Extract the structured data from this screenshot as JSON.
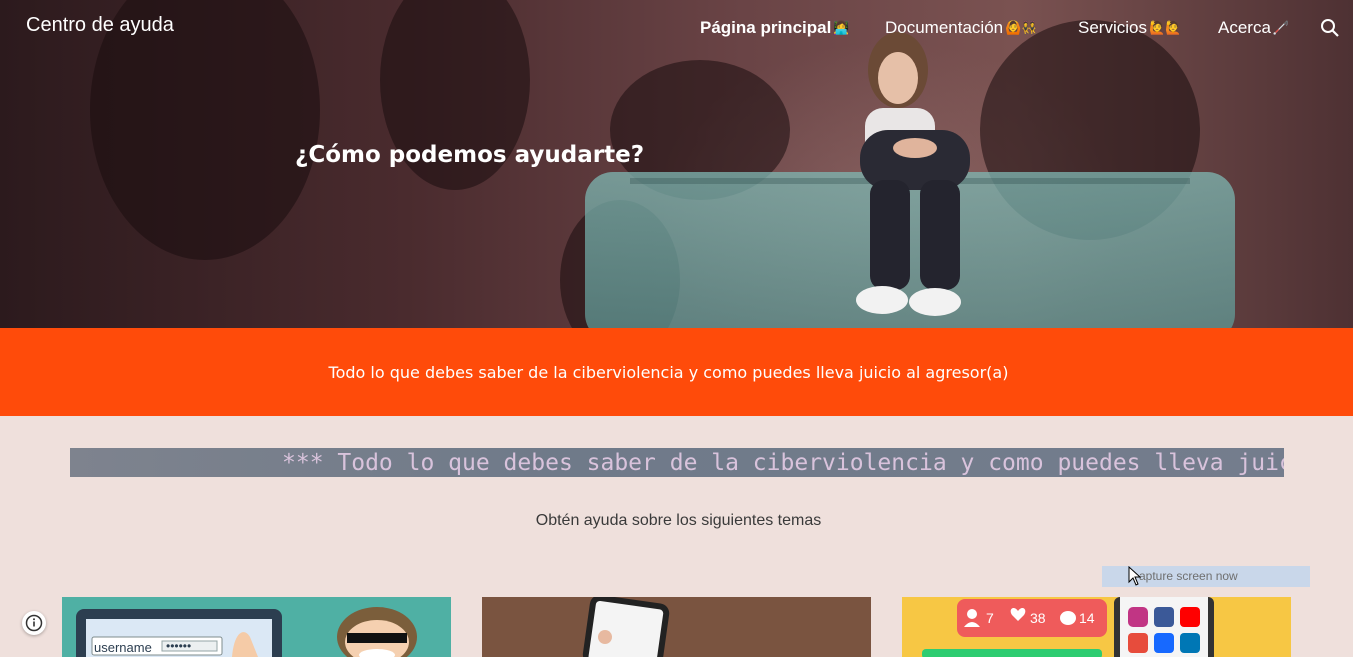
{
  "header": {
    "site_title": "Centro de ayuda",
    "nav": [
      {
        "label": "Página principal",
        "emoji": "👩‍💻",
        "active": true
      },
      {
        "label": "Documentación",
        "emoji": "🙆👯",
        "active": false
      },
      {
        "label": "Servicios",
        "emoji": "🙋🙋",
        "active": false
      },
      {
        "label": "Acerca",
        "emoji": "🦯",
        "active": false
      }
    ]
  },
  "hero": {
    "heading": "¿Cómo podemos ayudarte?"
  },
  "banner": {
    "text": "Todo lo que debes saber de la ciberviolencia y como puedes lleva juicio al agresor(a)"
  },
  "marquee": {
    "text": "*** Todo lo que debes saber de la ciberviolencia y como puedes lleva juicio al agre"
  },
  "topics": {
    "subtitle": "Obtén ayuda sobre los siguientes temas"
  },
  "overlay": {
    "capture_label": "apture screen now"
  },
  "cards": [
    {
      "image": "phishing-illustration",
      "username_text": "username",
      "password_dots": "••••••"
    },
    {
      "image": "phone-photo"
    },
    {
      "image": "social-media-illustration",
      "followers": "7",
      "likes": "38",
      "comments": "14"
    }
  ],
  "colors": {
    "banner": "#ff4b0a",
    "page_bg": "#efe0dc",
    "marquee_bg": "#7e838e",
    "marquee_text": "#d9c3dc"
  }
}
